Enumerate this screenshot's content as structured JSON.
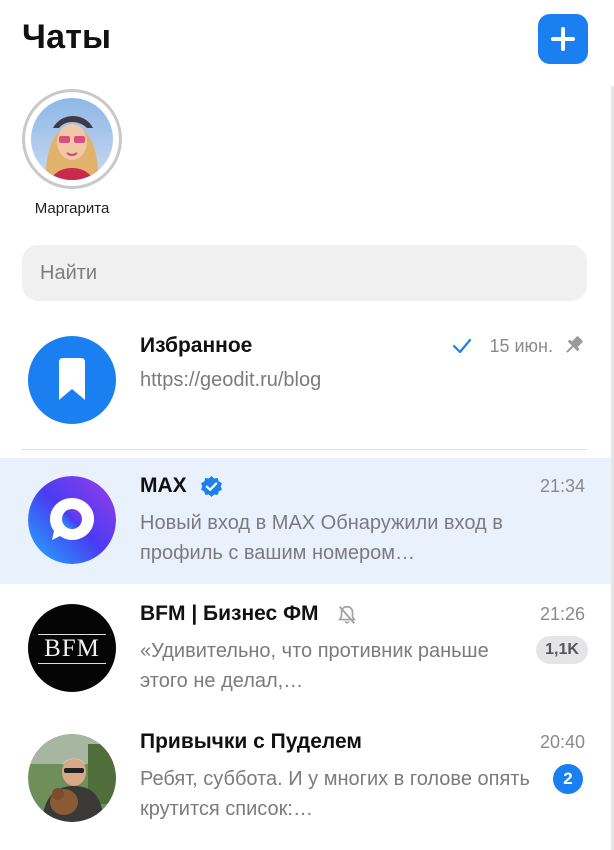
{
  "header": {
    "title": "Чаты",
    "add_icon": "plus-icon",
    "accent": "#1a7ff0"
  },
  "stories": [
    {
      "name": "Маргарита"
    }
  ],
  "search": {
    "placeholder": "Найти"
  },
  "chats": [
    {
      "name": "Избранное",
      "preview": "https://geodit.ru/blog",
      "time": "15 июн.",
      "status_icon": "check-icon",
      "pinned_icon": "pin-icon"
    },
    {
      "name": "MAX",
      "verified_icon": "verified-badge-icon",
      "preview": "Новый вход в MAX Обнаружили вход в профиль с вашим номером…",
      "time": "21:34"
    },
    {
      "name": "BFM | Бизнес ФМ",
      "muted_icon": "muted-bell-icon",
      "logo_text": "BFM",
      "preview": "«Удивительно, что противник раньше этого не делал,…",
      "time": "21:26",
      "badge": "1,1K"
    },
    {
      "name": "Привычки с Пуделем",
      "preview": "Ребят, суббота. И у многих в голове опять крутится список:…",
      "time": "20:40",
      "badge": "2"
    }
  ]
}
